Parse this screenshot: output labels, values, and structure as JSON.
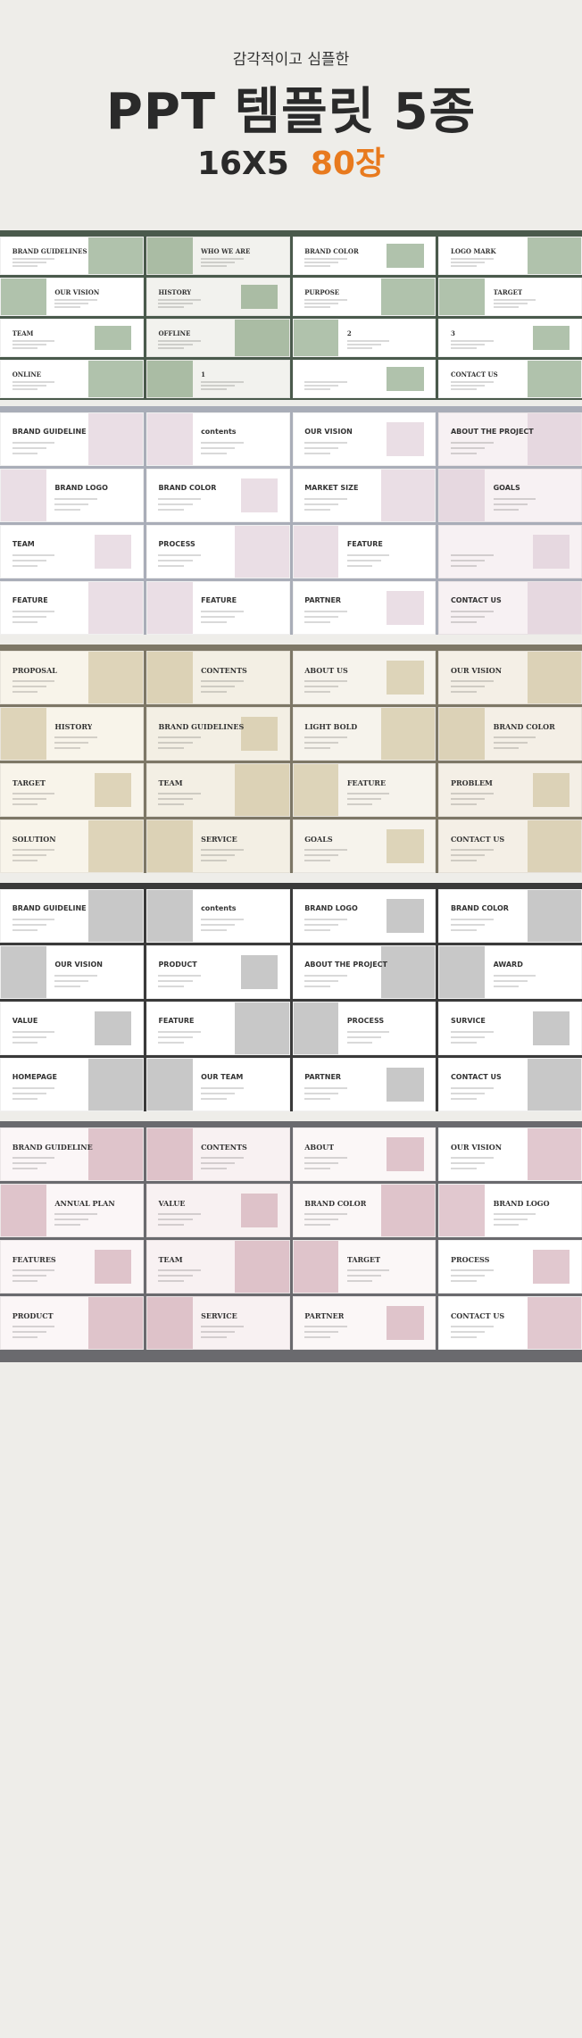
{
  "hero": {
    "subtitle": "감각적이고 심플한",
    "title": "PPT 템플릿 5종",
    "count_a": "16X5",
    "count_b": "80장",
    "accent_color": "#e87a1e"
  },
  "sets": [
    {
      "bg": "#4a5a4c",
      "accent": "#6f8f68",
      "rows": [
        [
          "BRAND GUIDELINES",
          "WHO WE ARE",
          "BRAND COLOR",
          "LOGO MARK"
        ],
        [
          "OUR VISION",
          "HISTORY",
          "PURPOSE",
          "TARGET"
        ],
        [
          "TEAM",
          "OFFLINE",
          "2",
          "3"
        ],
        [
          "ONLINE",
          "1",
          "",
          "CONTACT US"
        ]
      ]
    },
    {
      "bg": "#a9adb8",
      "accent": "#d9c3cf",
      "rows": [
        [
          "BRAND GUIDELINE",
          "contents",
          "OUR VISION",
          "ABOUT THE PROJECT"
        ],
        [
          "BRAND LOGO",
          "BRAND COLOR",
          "MARKET SIZE",
          "GOALS"
        ],
        [
          "TEAM",
          "PROCESS",
          "FEATURE",
          ""
        ],
        [
          "FEATURE",
          "FEATURE",
          "PARTNER",
          "CONTACT US"
        ]
      ]
    },
    {
      "bg": "#7d7766",
      "accent": "#c9b98f",
      "rows": [
        [
          "PROPOSAL",
          "CONTENTS",
          "ABOUT US",
          "OUR VISION"
        ],
        [
          "HISTORY",
          "BRAND GUIDELINES",
          "LIGHT  BOLD",
          "BRAND COLOR"
        ],
        [
          "TARGET",
          "TEAM",
          "FEATURE",
          "PROBLEM"
        ],
        [
          "SOLUTION",
          "SERVICE",
          "GOALS",
          "CONTACT US"
        ]
      ]
    },
    {
      "bg": "#3a3a3a",
      "accent": "#9a9a9a",
      "rows": [
        [
          "BRAND GUIDELINE",
          "contents",
          "BRAND LOGO",
          "BRAND COLOR"
        ],
        [
          "OUR VISION",
          "PRODUCT",
          "ABOUT THE PROJECT",
          "AWARD"
        ],
        [
          "VALUE",
          "FEATURE",
          "PROCESS",
          "SURVICE"
        ],
        [
          "HOMEPAGE",
          "OUR TEAM",
          "PARTNER",
          "CONTACT US"
        ]
      ]
    },
    {
      "bg": "#6a6a6e",
      "accent": "#c99aa8",
      "rows": [
        [
          "BRAND GUIDELINE",
          "CONTENTS",
          "ABOUT",
          "OUR VISION"
        ],
        [
          "ANNUAL PLAN",
          "VALUE",
          "BRAND COLOR",
          "BRAND LOGO"
        ],
        [
          "FEATURES",
          "TEAM",
          "TARGET",
          "PROCESS"
        ],
        [
          "PRODUCT",
          "SERVICE",
          "PARTNER",
          "CONTACT US"
        ]
      ]
    }
  ]
}
